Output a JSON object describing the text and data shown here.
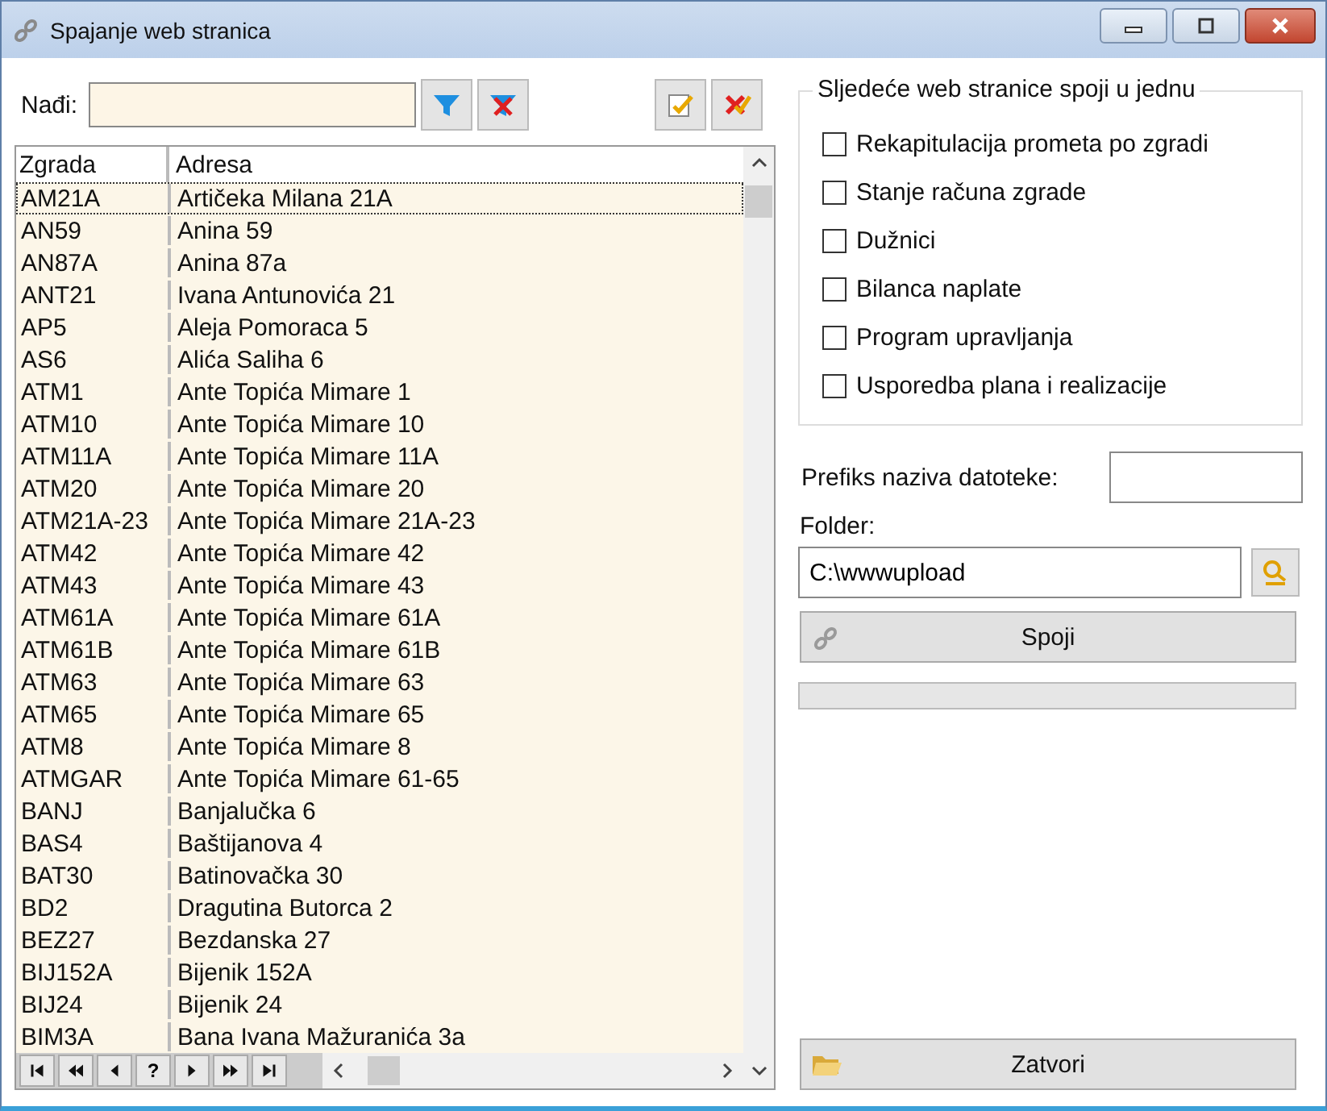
{
  "window": {
    "title": "Spajanje web stranica"
  },
  "search": {
    "label": "Nađi:"
  },
  "table": {
    "columns": [
      "Zgrada",
      "Adresa"
    ],
    "rows": [
      {
        "code": "AM21A",
        "address": "Artičeka Milana 21A",
        "selected": true
      },
      {
        "code": "AN59",
        "address": "Anina 59",
        "selected": false
      },
      {
        "code": "AN87A",
        "address": "Anina 87a",
        "selected": false
      },
      {
        "code": "ANT21",
        "address": "Ivana Antunovića 21",
        "selected": false
      },
      {
        "code": "AP5",
        "address": "Aleja Pomoraca 5",
        "selected": false
      },
      {
        "code": "AS6",
        "address": "Alića Saliha 6",
        "selected": false
      },
      {
        "code": "ATM1",
        "address": "Ante Topića Mimare 1",
        "selected": false
      },
      {
        "code": "ATM10",
        "address": "Ante Topića Mimare 10",
        "selected": false
      },
      {
        "code": "ATM11A",
        "address": "Ante Topića Mimare 11A",
        "selected": false
      },
      {
        "code": "ATM20",
        "address": "Ante Topića Mimare 20",
        "selected": false
      },
      {
        "code": "ATM21A-23",
        "address": "Ante Topića Mimare 21A-23",
        "selected": false
      },
      {
        "code": "ATM42",
        "address": "Ante Topića Mimare 42",
        "selected": false
      },
      {
        "code": "ATM43",
        "address": "Ante Topića Mimare 43",
        "selected": false
      },
      {
        "code": "ATM61A",
        "address": "Ante Topića Mimare 61A",
        "selected": false
      },
      {
        "code": "ATM61B",
        "address": "Ante Topića Mimare 61B",
        "selected": false
      },
      {
        "code": "ATM63",
        "address": "Ante Topića Mimare 63",
        "selected": false
      },
      {
        "code": "ATM65",
        "address": "Ante Topića Mimare 65",
        "selected": false
      },
      {
        "code": "ATM8",
        "address": "Ante Topića Mimare 8",
        "selected": false
      },
      {
        "code": "ATMGAR",
        "address": "Ante Topića Mimare 61-65",
        "selected": false
      },
      {
        "code": "BANJ",
        "address": "Banjalučka 6",
        "selected": false
      },
      {
        "code": "BAS4",
        "address": "Baštijanova 4",
        "selected": false
      },
      {
        "code": "BAT30",
        "address": "Batinovačka 30",
        "selected": false
      },
      {
        "code": "BD2",
        "address": "Dragutina Butorca 2",
        "selected": false
      },
      {
        "code": "BEZ27",
        "address": "Bezdanska 27",
        "selected": false
      },
      {
        "code": "BIJ152A",
        "address": "Bijenik 152A",
        "selected": false
      },
      {
        "code": "BIJ24",
        "address": "Bijenik 24",
        "selected": false
      },
      {
        "code": "BIM3A",
        "address": "Bana Ivana Mažuranića 3a",
        "selected": false
      }
    ],
    "navigator": [
      {
        "kind": "first"
      },
      {
        "kind": "prev-page"
      },
      {
        "kind": "prev"
      },
      {
        "kind": "text",
        "label": "?"
      },
      {
        "kind": "next"
      },
      {
        "kind": "next-page"
      },
      {
        "kind": "last"
      }
    ]
  },
  "merge_group": {
    "title": "Sljedeće web stranice spoji u jednu",
    "options": [
      {
        "label": "Rekapitulacija prometa po zgradi",
        "checked": false
      },
      {
        "label": "Stanje računa zgrade",
        "checked": false
      },
      {
        "label": "Dužnici",
        "checked": false
      },
      {
        "label": "Bilanca naplate",
        "checked": false
      },
      {
        "label": "Program upravljanja",
        "checked": false
      },
      {
        "label": "Usporedba plana i realizacije",
        "checked": false
      }
    ]
  },
  "prefix": {
    "label": "Prefiks naziva datoteke:"
  },
  "folder": {
    "label": "Folder:",
    "value": "C:\\wwwupload"
  },
  "merge_button": {
    "label": "Spoji"
  },
  "progress": {
    "level": 0
  },
  "close_button": {
    "label": "Zatvori"
  }
}
